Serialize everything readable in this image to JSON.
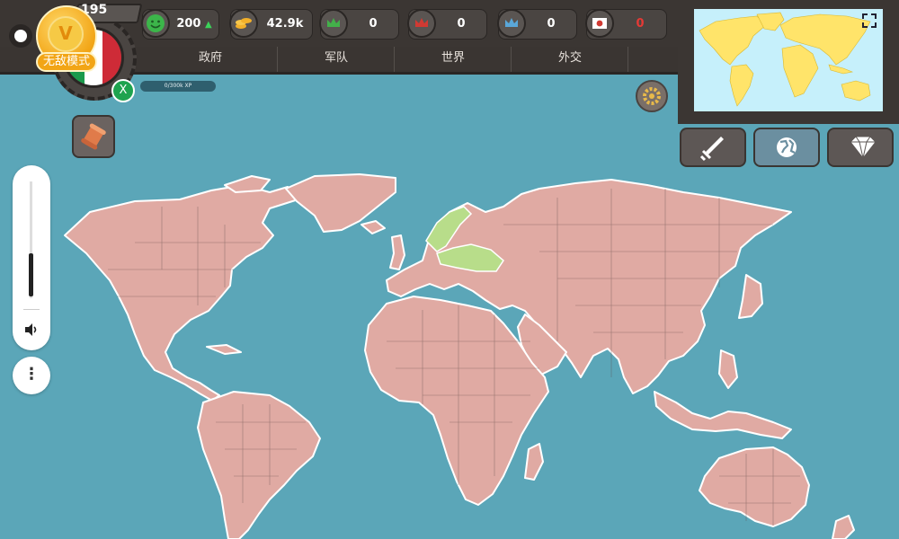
{
  "player": {
    "level": "195",
    "badge_label": "无敌模式",
    "badge_letter": "V",
    "xp": "0/300k XP",
    "x_label": "X",
    "flag_colors": [
      "#1b9a4b",
      "#ffffff",
      "#ce2b37"
    ]
  },
  "stats": [
    {
      "name": "happiness",
      "value": "200",
      "trend": "up",
      "color": "#3cb54a"
    },
    {
      "name": "gold",
      "value": "42.9k",
      "trend": "down",
      "color": "#f2b02a"
    },
    {
      "name": "green-crown",
      "value": "0",
      "color": "#43b04a"
    },
    {
      "name": "red-crown",
      "value": "0",
      "color": "#d13a33"
    },
    {
      "name": "blue-crown",
      "value": "0",
      "color": "#5aa7d8"
    },
    {
      "name": "japan-flag",
      "value": "0",
      "value_color": "#e53935"
    }
  ],
  "nav_tabs": [
    "政府",
    "军队",
    "世界",
    "外交"
  ],
  "colors": {
    "sea": "#5ba6b8",
    "land": "#e0aaa3",
    "player_territory": "#b8dd8a",
    "border": "#3b3633",
    "minimap_land": "#ffe46a",
    "minimap_sea": "#c6f0fb"
  },
  "icons": {
    "scroll": "scroll-icon",
    "settings": "gear-icon",
    "expand": "expand-icon",
    "speaker": "speaker-icon",
    "more": "more-vertical-icon"
  },
  "actions": [
    {
      "name": "war",
      "icon": "sword-icon"
    },
    {
      "name": "world",
      "icon": "globe-icon"
    },
    {
      "name": "shop",
      "icon": "diamond-icon"
    }
  ]
}
